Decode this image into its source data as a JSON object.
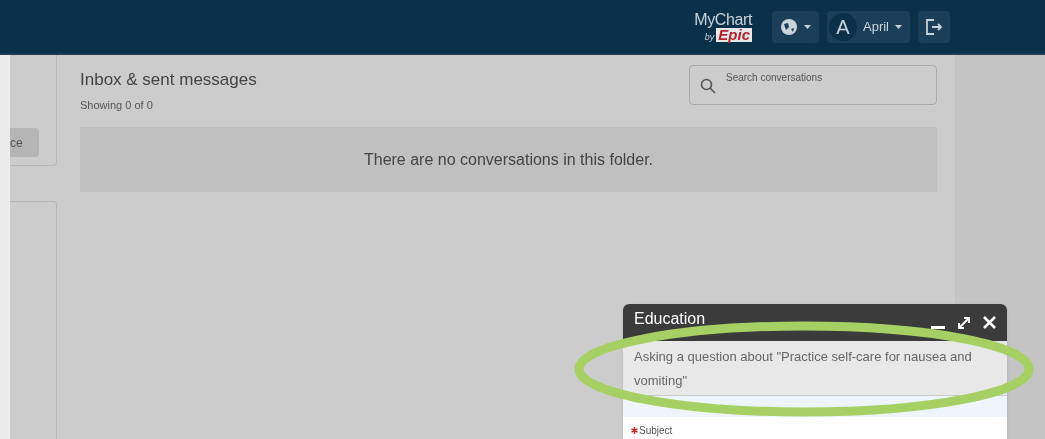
{
  "header": {
    "logo_top": "MyChart",
    "logo_by": "by",
    "logo_brand": "Epic",
    "user_initial": "A",
    "user_name": "April"
  },
  "sidebar": {
    "button_label": "ce"
  },
  "inbox": {
    "title": "Inbox & sent messages",
    "count": "Showing 0 of 0",
    "search": {
      "placeholder": "Search conversations"
    },
    "empty_message": "There are no conversations in this folder."
  },
  "dialog": {
    "title": "Education",
    "topic": "Asking a question about \"Practice self-care for nausea and vomiting\"",
    "fields": [
      {
        "label": "Subject",
        "required": true
      }
    ]
  }
}
